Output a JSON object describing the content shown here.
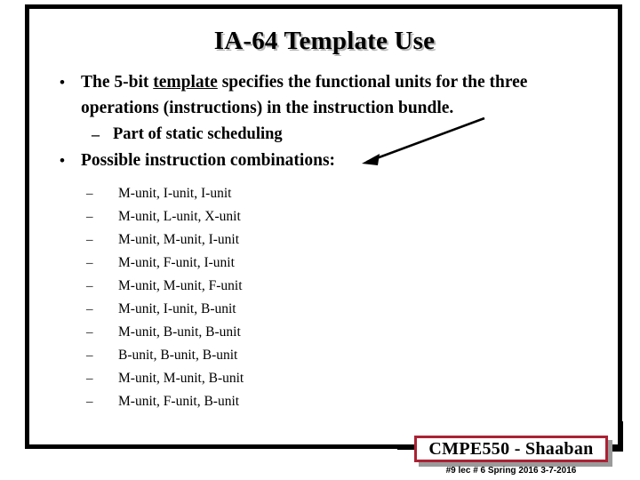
{
  "slide": {
    "title": "IA-64 Template Use",
    "bullets": [
      {
        "level": 1,
        "marker": "•",
        "text_before": "The 5-bit ",
        "underlined": "template",
        "text_after": " specifies the functional units for the three operations (instructions) in the instruction bundle."
      },
      {
        "level": 2,
        "marker": "–",
        "text": "Part of static scheduling"
      },
      {
        "level": 1,
        "marker": "•",
        "text": "Possible instruction combinations:"
      }
    ],
    "combinations_marker": "–",
    "combinations": [
      "M-unit, I-unit, I-unit",
      "M-unit, L-unit, X-unit",
      "M-unit, M-unit, I-unit",
      "M-unit, F-unit, I-unit",
      "M-unit, M-unit, F-unit",
      "M-unit, I-unit, B-unit",
      "M-unit, B-unit, B-unit",
      "B-unit, B-unit, B-unit",
      "M-unit, M-unit, B-unit",
      "M-unit, F-unit, B-unit"
    ],
    "annotation": {
      "name": "arrow-annotation",
      "color": "#000000"
    },
    "footer": {
      "signature": "CMPE550 - Shaaban",
      "meta": "#9   lec # 6   Spring 2016   3-7-2016",
      "box_border_color": "#aa2233",
      "box_shadow_color": "#9a9a9a"
    },
    "frame_color": "#000000",
    "background_color": "#ffffff"
  }
}
